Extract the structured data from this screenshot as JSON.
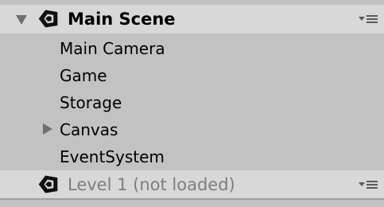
{
  "hierarchy": {
    "scenes": [
      {
        "name": "Main Scene",
        "expanded": true,
        "loaded": true,
        "children": [
          {
            "label": "Main Camera",
            "has_children": false
          },
          {
            "label": "Game",
            "has_children": false
          },
          {
            "label": "Storage",
            "has_children": false
          },
          {
            "label": "Canvas",
            "has_children": true,
            "expanded": false
          },
          {
            "label": "EventSystem",
            "has_children": false
          }
        ]
      },
      {
        "name": "Level 1 (not loaded)",
        "expanded": false,
        "loaded": false
      }
    ],
    "icons": {
      "scene": "unity-scene-icon",
      "foldout_open": "triangle-down-icon",
      "foldout_closed": "triangle-right-icon",
      "menu": "scene-options-menu-icon"
    },
    "colors": {
      "background": "#c2c2c2",
      "scene_header": "#d8d8d8",
      "text": "#000000",
      "dim_text": "#7e7e7e",
      "foldout": "#6f6f6f"
    }
  }
}
